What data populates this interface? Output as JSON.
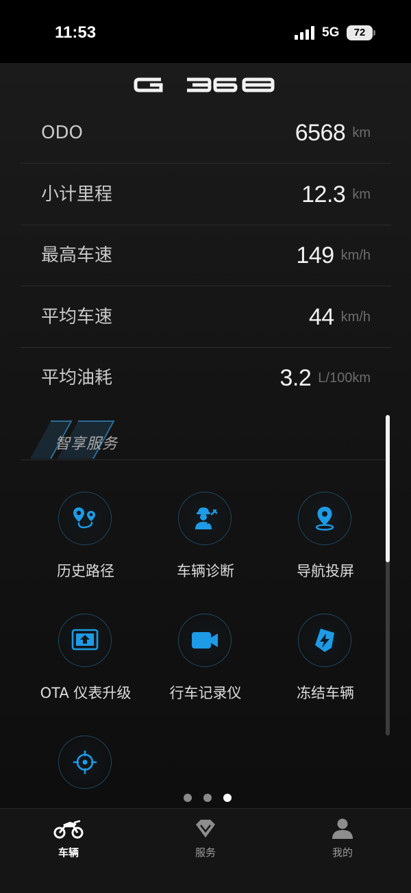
{
  "status_bar": {
    "time": "11:53",
    "network": "5G",
    "battery": "72"
  },
  "header": {
    "logo_text": "G 368"
  },
  "stats": [
    {
      "label": "ODO",
      "value": "6568",
      "unit": "km"
    },
    {
      "label": "小计里程",
      "value": "12.3",
      "unit": "km"
    },
    {
      "label": "最高车速",
      "value": "149",
      "unit": "km/h"
    },
    {
      "label": "平均车速",
      "value": "44",
      "unit": "km/h"
    },
    {
      "label": "平均油耗",
      "value": "3.2",
      "unit": "L/100km"
    }
  ],
  "services": {
    "title": "智享服务",
    "items": [
      {
        "label": "历史路径",
        "icon": "route-icon"
      },
      {
        "label": "车辆诊断",
        "icon": "mechanic-icon"
      },
      {
        "label": "导航投屏",
        "icon": "location-pin-icon"
      },
      {
        "label": "OTA 仪表升级",
        "icon": "upload-screen-icon"
      },
      {
        "label": "行车记录仪",
        "icon": "video-camera-icon"
      },
      {
        "label": "冻结车辆",
        "icon": "lightning-shield-icon"
      },
      {
        "label": "",
        "icon": "locate-target-icon"
      }
    ]
  },
  "pagination": {
    "count": 3,
    "active_index": 2
  },
  "tabbar": {
    "tabs": [
      {
        "label": "车辆",
        "icon": "motorcycle-icon",
        "active": true
      },
      {
        "label": "服务",
        "icon": "diamond-icon",
        "active": false
      },
      {
        "label": "我的",
        "icon": "user-icon",
        "active": false
      }
    ]
  },
  "colors": {
    "accent": "#1e9be6",
    "background": "#141414",
    "icon_ring": "#1e4a66"
  }
}
